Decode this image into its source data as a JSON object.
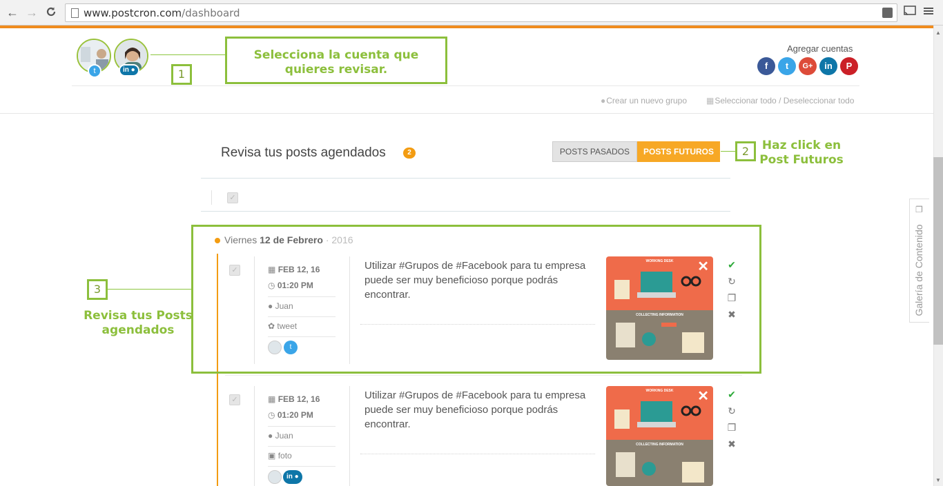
{
  "browser": {
    "url_host": "www.postcron.com",
    "url_path": "/dashboard",
    "back_icon": "←",
    "forward_icon": "→",
    "reload_icon": "C"
  },
  "header": {
    "accounts": [
      {
        "name": "twitter-account",
        "network": "twitter"
      },
      {
        "name": "linkedin-account",
        "network": "linkedin"
      }
    ],
    "add_accounts_label": "Agregar cuentas",
    "social_buttons": [
      {
        "label": "f",
        "color": "#3b5998"
      },
      {
        "label": "t",
        "color": "#3aa5e8"
      },
      {
        "label": "G+",
        "color": "#dd4b39"
      },
      {
        "label": "in",
        "color": "#0e76a8"
      },
      {
        "label": "P",
        "color": "#cb2027"
      }
    ],
    "create_group": "Crear un nuevo grupo",
    "select_all": "Seleccionar todo / Deseleccionar todo"
  },
  "callouts": {
    "c1_number": "1",
    "c1_text": "Selecciona la cuenta que quieres revisar.",
    "c2_number": "2",
    "c2_line1": "Haz click en",
    "c2_line2": "Post Futuros",
    "c3_number": "3",
    "c3_line1": "Revisa tus Posts",
    "c3_line2": "agendados"
  },
  "main": {
    "title": "Revisa tus posts agendados",
    "count": "2",
    "tab_past": "POSTS PASADOS",
    "tab_future": "POSTS FUTUROS"
  },
  "date_group": {
    "day": "Viernes",
    "date": "12 de Febrero",
    "sep": " · ",
    "year": "2016"
  },
  "posts": [
    {
      "date": "FEB 12, 16",
      "time": "01:20 PM",
      "author": "Juan",
      "type": "tweet",
      "type_icon": "twitter-icon",
      "text": "Utilizar #Grupos de #Facebook para tu empresa puede ser muy beneficioso porque podrás encontrar."
    },
    {
      "date": "FEB 12, 16",
      "time": "01:20 PM",
      "author": "Juan",
      "type": "foto",
      "type_icon": "camera-icon",
      "text": "Utilizar #Grupos de #Facebook para tu empresa puede ser muy beneficioso porque podrás encontrar."
    }
  ],
  "thumbnail": {
    "top_label": "WORKING DESK",
    "bottom_label": "COLLECTING INFORMATION"
  },
  "side_tab": {
    "label": "Galería de Contenido"
  },
  "colors": {
    "accent_orange": "#f39c12",
    "callout_green": "#8cbf3c",
    "tab_future_bg": "#f7a825"
  }
}
